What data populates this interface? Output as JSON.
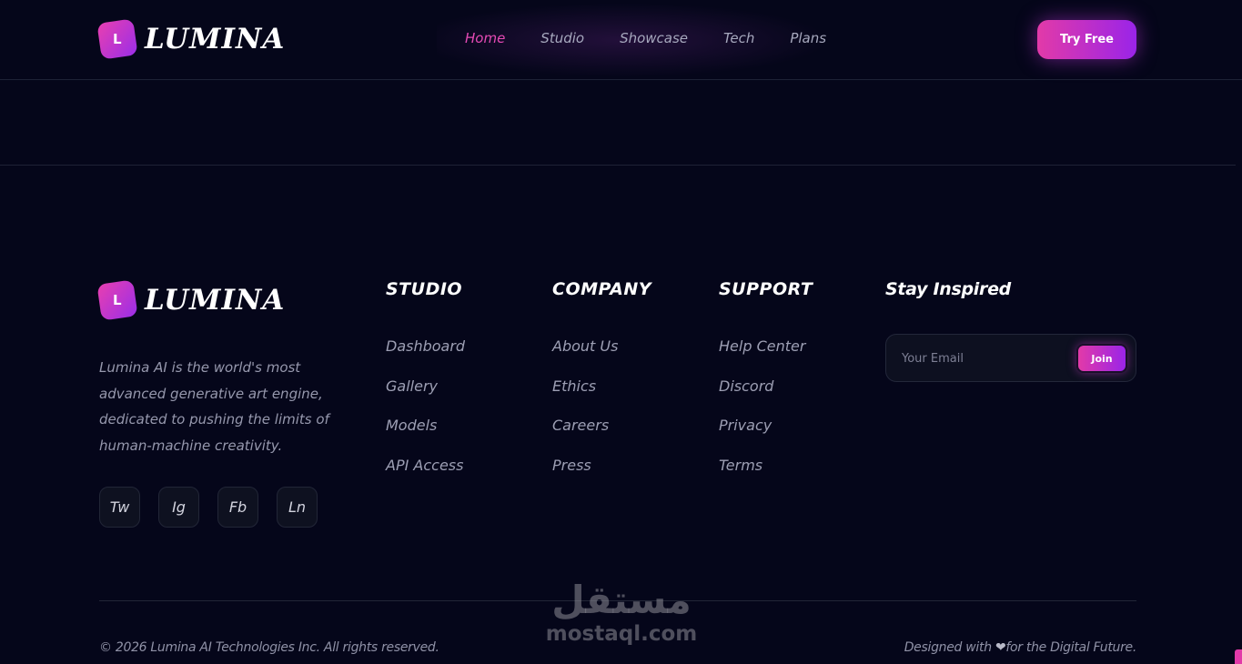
{
  "brand": {
    "logo_letter": "L",
    "name": "LUMINA"
  },
  "nav": {
    "links": [
      "Home",
      "Studio",
      "Showcase",
      "Tech",
      "Plans"
    ],
    "active": "Home",
    "cta_label": "Try Free"
  },
  "footer": {
    "description": "Lumina AI is the world's most advanced generative art engine, dedicated to pushing the limits of human-machine creativity.",
    "socials": [
      "Tw",
      "Ig",
      "Fb",
      "Ln"
    ],
    "columns": [
      {
        "title": "STUDIO",
        "links": [
          "Dashboard",
          "Gallery",
          "Models",
          "API Access"
        ]
      },
      {
        "title": "COMPANY",
        "links": [
          "About Us",
          "Ethics",
          "Careers",
          "Press"
        ]
      },
      {
        "title": "SUPPORT",
        "links": [
          "Help Center",
          "Discord",
          "Privacy",
          "Terms"
        ]
      }
    ],
    "newsletter": {
      "title": "Stay Inspired",
      "placeholder": "Your Email",
      "button_label": "Join"
    },
    "copyright": "© 2026 Lumina AI Technologies Inc. All rights reserved.",
    "designed_prefix": "Designed with",
    "designed_heart": "❤",
    "designed_suffix": "for the Digital Future."
  },
  "watermark": {
    "arabic": "مستقل",
    "latin": "mostaql.com"
  },
  "colors": {
    "accent_pink": "#e23aa8",
    "accent_purple": "#9a24e8",
    "background": "#05061a"
  }
}
